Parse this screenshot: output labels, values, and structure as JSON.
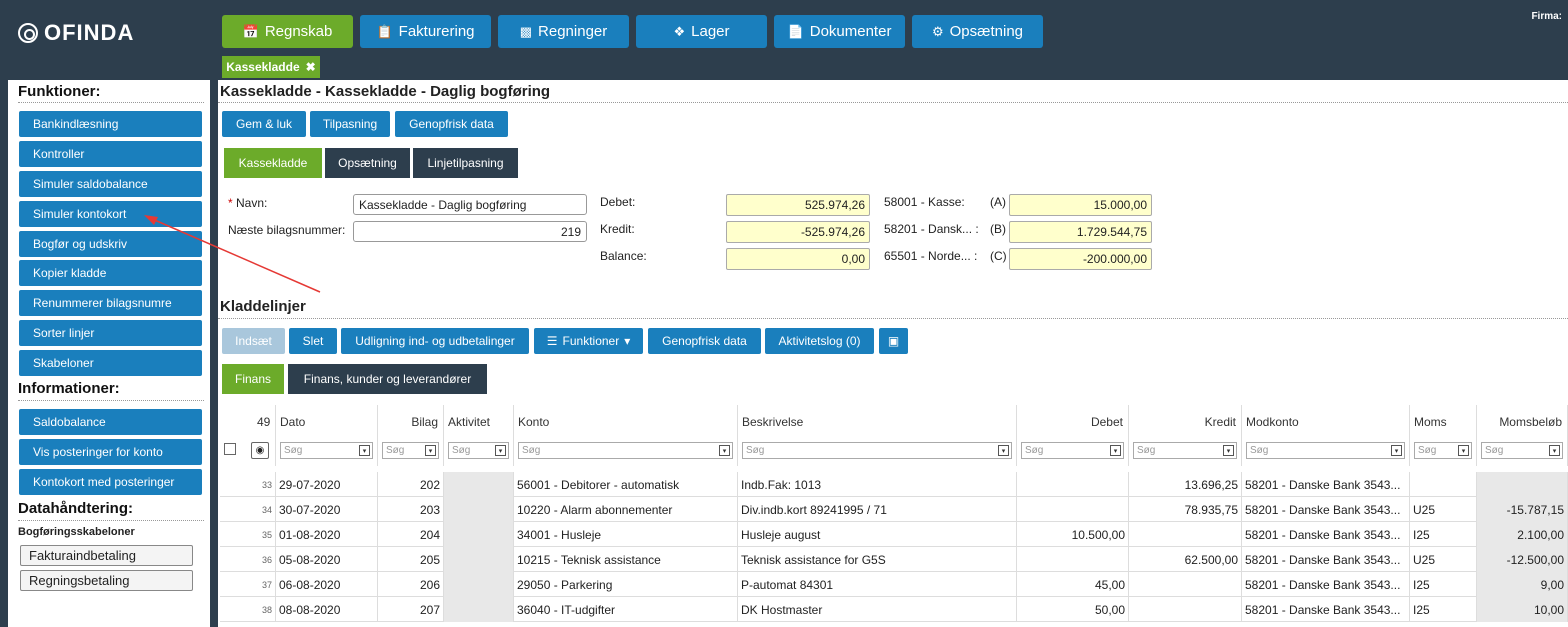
{
  "app": {
    "logo": "OFINDA",
    "firma_label": "Firma:"
  },
  "nav": [
    {
      "label": "Regnskab",
      "icon": "calendar-icon",
      "active": true
    },
    {
      "label": "Fakturering",
      "icon": "clipboard-icon",
      "active": false
    },
    {
      "label": "Regninger",
      "icon": "bar-chart-icon",
      "active": false
    },
    {
      "label": "Lager",
      "icon": "cubes-icon",
      "active": false
    },
    {
      "label": "Dokumenter",
      "icon": "file-icon",
      "active": false
    },
    {
      "label": "Opsætning",
      "icon": "gear-icon",
      "active": false
    }
  ],
  "open_tab": {
    "label": "Kassekladde"
  },
  "sidebar": {
    "functions_heading": "Funktioner:",
    "functions": [
      "Bankindlæsning",
      "Kontroller",
      "Simuler saldobalance",
      "Simuler kontokort",
      "Bogfør og udskriv",
      "Kopier kladde",
      "Renummerer bilagsnumre",
      "Sorter linjer",
      "Skabeloner"
    ],
    "info_heading": "Informationer:",
    "info": [
      "Saldobalance",
      "Vis posteringer for konto",
      "Kontokort med posteringer"
    ],
    "data_heading": "Datahåndtering:",
    "templates_heading": "Bogføringsskabeloner",
    "templates": [
      "Fakturaindbetaling",
      "Regningsbetaling"
    ]
  },
  "main": {
    "title": "Kassekladde - Kassekladde - Daglig bogføring",
    "toolbar": [
      "Gem & luk",
      "Tilpasning",
      "Genopfrisk data"
    ],
    "tabs": [
      "Kassekladde",
      "Opsætning",
      "Linjetilpasning"
    ],
    "form": {
      "name_label": "Navn:",
      "name_required": "*",
      "name_value": "Kassekladde - Daglig bogføring",
      "next_label": "Næste bilagsnummer:",
      "next_value": "219",
      "debet_label": "Debet:",
      "debet_value": "525.974,26",
      "kredit_label": "Kredit:",
      "kredit_value": "-525.974,26",
      "balance_label": "Balance:",
      "balance_value": "0,00",
      "accounts": [
        {
          "name": "58001 - Kasse:",
          "code": "(A)",
          "value": "15.000,00"
        },
        {
          "name": "58201 - Dansk... :",
          "code": "(B)",
          "value": "1.729.544,75"
        },
        {
          "name": "65501 - Norde... :",
          "code": "(C)",
          "value": "-200.000,00"
        }
      ]
    },
    "lines_title": "Kladdelinjer",
    "lines_toolbar": [
      "Indsæt",
      "Slet",
      "Udligning ind- og udbetalinger",
      "Funktioner",
      "Genopfrisk data",
      "Aktivitetslog (0)"
    ],
    "lines_tabs": [
      "Finans",
      "Finans, kunder og leverandører"
    ],
    "grid": {
      "count": "49",
      "filter_placeholder": "Søg",
      "columns": [
        "Dato",
        "Bilag",
        "Aktivitet",
        "Konto",
        "Beskrivelse",
        "Debet",
        "Kredit",
        "Modkonto",
        "Moms",
        "Momsbeløb"
      ],
      "rows": [
        {
          "n": "33",
          "dato": "29-07-2020",
          "bilag": "202",
          "aktivitet": "",
          "konto": "56001 - Debitorer - automatisk",
          "beskrivelse": "Indb.Fak: 1013",
          "debet": "",
          "kredit": "13.696,25",
          "modkonto": "58201 - Danske Bank 3543...",
          "moms": "",
          "momsbelob": ""
        },
        {
          "n": "34",
          "dato": "30-07-2020",
          "bilag": "203",
          "aktivitet": "",
          "konto": "10220 - Alarm abonnementer",
          "beskrivelse": "Div.indb.kort 89241995 / 71",
          "debet": "",
          "kredit": "78.935,75",
          "modkonto": "58201 - Danske Bank 3543...",
          "moms": "U25",
          "momsbelob": "-15.787,15"
        },
        {
          "n": "35",
          "dato": "01-08-2020",
          "bilag": "204",
          "aktivitet": "",
          "konto": "34001 - Husleje",
          "beskrivelse": "Husleje august",
          "debet": "10.500,00",
          "kredit": "",
          "modkonto": "58201 - Danske Bank 3543...",
          "moms": "I25",
          "momsbelob": "2.100,00"
        },
        {
          "n": "36",
          "dato": "05-08-2020",
          "bilag": "205",
          "aktivitet": "",
          "konto": "10215 - Teknisk assistance",
          "beskrivelse": "Teknisk assistance for G5S",
          "debet": "",
          "kredit": "62.500,00",
          "modkonto": "58201 - Danske Bank 3543...",
          "moms": "U25",
          "momsbelob": "-12.500,00"
        },
        {
          "n": "37",
          "dato": "06-08-2020",
          "bilag": "206",
          "aktivitet": "",
          "konto": "29050 - Parkering",
          "beskrivelse": "P-automat 84301",
          "debet": "45,00",
          "kredit": "",
          "modkonto": "58201 - Danske Bank 3543...",
          "moms": "I25",
          "momsbelob": "9,00"
        },
        {
          "n": "38",
          "dato": "08-08-2020",
          "bilag": "207",
          "aktivitet": "",
          "konto": "36040 - IT-udgifter",
          "beskrivelse": "DK Hostmaster",
          "debet": "50,00",
          "kredit": "",
          "modkonto": "58201 - Danske Bank 3543...",
          "moms": "I25",
          "momsbelob": "10,00"
        }
      ]
    }
  },
  "colors": {
    "header": "#2d3e4d",
    "primary": "#1a7fbd",
    "active": "#6cab2a",
    "highlight": "#ffffcc",
    "annotation": "#e53935"
  }
}
